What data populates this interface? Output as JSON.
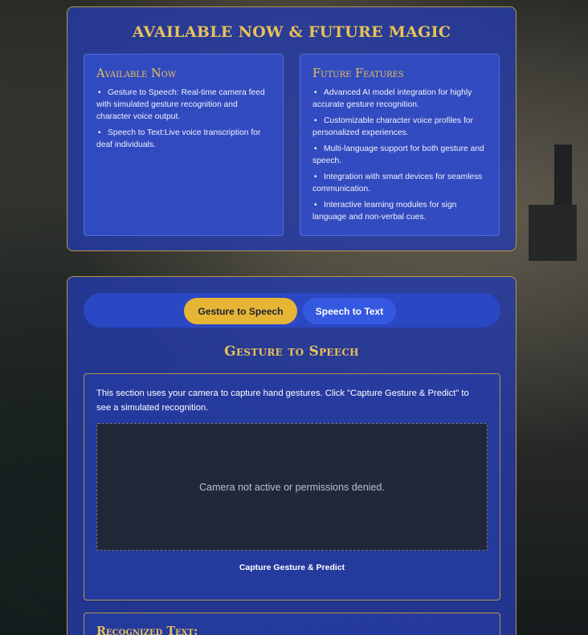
{
  "features_panel": {
    "title": "AVAILABLE NOW & FUTURE MAGIC",
    "available_now": {
      "heading": "Available Now",
      "items": [
        "Gesture to Speech: Real-time camera feed with simulated gesture recognition and character voice output.",
        "Speech to Text:Live voice transcription for deaf individuals."
      ]
    },
    "future_features": {
      "heading": "Future Features",
      "items": [
        "Advanced AI model integration for highly accurate gesture recognition.",
        "Customizable character voice profiles for personalized experiences.",
        "Multi-language support for both gesture and speech.",
        "Integration with smart devices for seamless communication.",
        "Interactive learning modules for sign language and non-verbal cues."
      ]
    }
  },
  "mode_tabs": {
    "gesture_label": "Gesture to Speech",
    "speech_label": "Speech to Text",
    "active": "gesture"
  },
  "gesture_section": {
    "title": "Gesture to Speech",
    "description": "This section uses your camera to capture hand gestures. Click \"Capture Gesture & Predict\" to see a simulated recognition.",
    "camera_status": "Camera not active or permissions denied.",
    "capture_label": "Capture Gesture & Predict"
  },
  "recognized": {
    "heading": "Recognized Text:"
  },
  "colors": {
    "panel_blue": "#243aa8",
    "gold_accent": "#e8c15a",
    "active_tab": "#e6b536",
    "inactive_tab": "#3558e0",
    "border_gold": "#b4954a"
  },
  "bullet_glyph": "•"
}
